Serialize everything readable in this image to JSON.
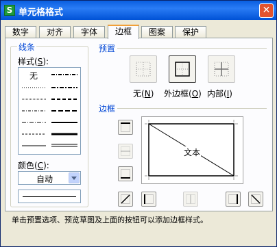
{
  "window": {
    "title": "单元格格式",
    "app_icon": "S",
    "close_glyph": "✕"
  },
  "tabs": [
    {
      "label": "数字",
      "active": false
    },
    {
      "label": "对齐",
      "active": false
    },
    {
      "label": "字体",
      "active": false
    },
    {
      "label": "边框",
      "active": true
    },
    {
      "label": "图案",
      "active": false
    },
    {
      "label": "保护",
      "active": false
    }
  ],
  "line_group": {
    "title": "线条",
    "style_label": "样式",
    "style_key": "S",
    "none_option": "无",
    "color_label": "颜色",
    "color_key": "C",
    "color_value": "自动"
  },
  "presets": {
    "title": "预置",
    "none": {
      "label": "无",
      "key": "N"
    },
    "outline": {
      "label": "外边框",
      "key": "O"
    },
    "inside": {
      "label": "内部",
      "key": "I"
    }
  },
  "border": {
    "title": "边框",
    "preview_text": "文本"
  },
  "footer": {
    "hint": "单击预置选项、预览草图及上面的按钮可以添加边框样式。"
  },
  "colors": {
    "title_bar": "#0a5fe0",
    "dialog_bg": "#ece9d8",
    "group_title": "#0046d5",
    "active_tab_accent": "#f1a038"
  }
}
